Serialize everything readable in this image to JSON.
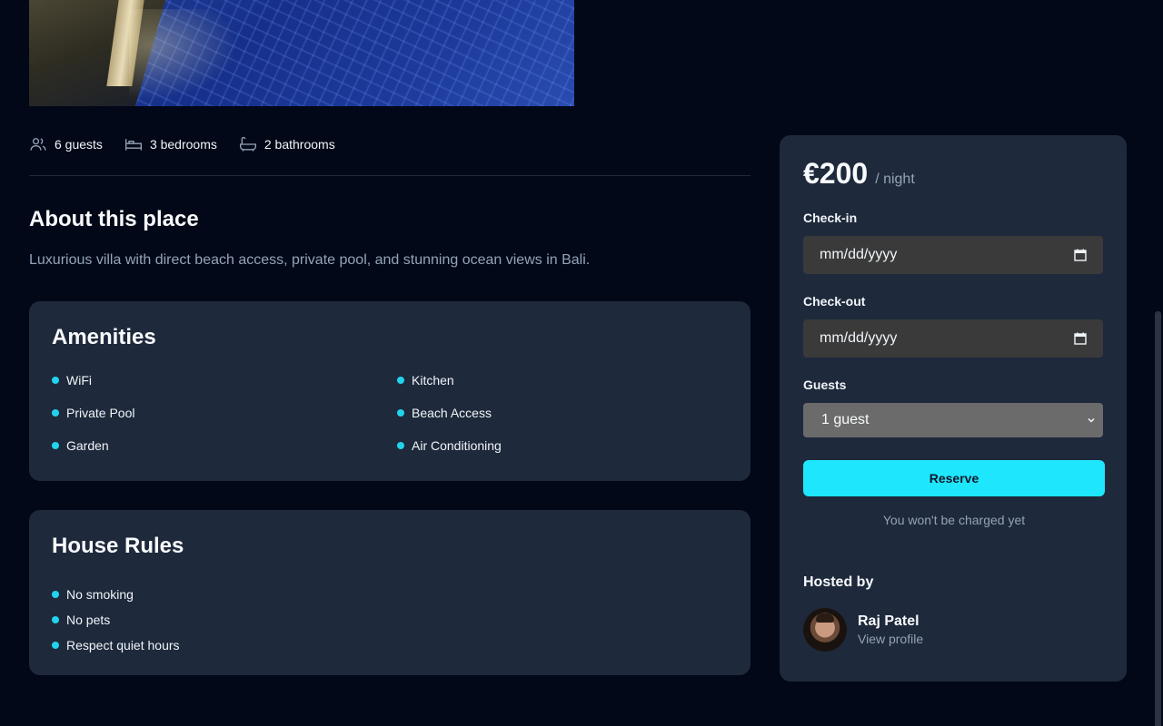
{
  "features": [
    {
      "icon": "guests-icon",
      "label": "6 guests"
    },
    {
      "icon": "bed-icon",
      "label": "3 bedrooms"
    },
    {
      "icon": "bath-icon",
      "label": "2 bathrooms"
    }
  ],
  "about": {
    "title": "About this place",
    "description": "Luxurious villa with direct beach access, private pool, and stunning ocean views in Bali."
  },
  "amenities": {
    "title": "Amenities",
    "items": [
      "WiFi",
      "Kitchen",
      "Private Pool",
      "Beach Access",
      "Garden",
      "Air Conditioning"
    ]
  },
  "house_rules": {
    "title": "House Rules",
    "items": [
      "No smoking",
      "No pets",
      "Respect quiet hours"
    ]
  },
  "booking": {
    "price": "€200",
    "per_night": "/ night",
    "checkin_label": "Check-in",
    "checkin_value": "mm/dd/yyyy",
    "checkout_label": "Check-out",
    "checkout_value": "mm/dd/yyyy",
    "guests_label": "Guests",
    "guests_value": "1 guest",
    "reserve_label": "Reserve",
    "note": "You won't be charged yet",
    "hosted_by": "Hosted by",
    "host_name": "Raj Patel",
    "host_link": "View profile"
  },
  "colors": {
    "background": "#020817",
    "card": "#1e293b",
    "accent": "#22d3ee",
    "reserve_button": "#1ee6fc"
  }
}
